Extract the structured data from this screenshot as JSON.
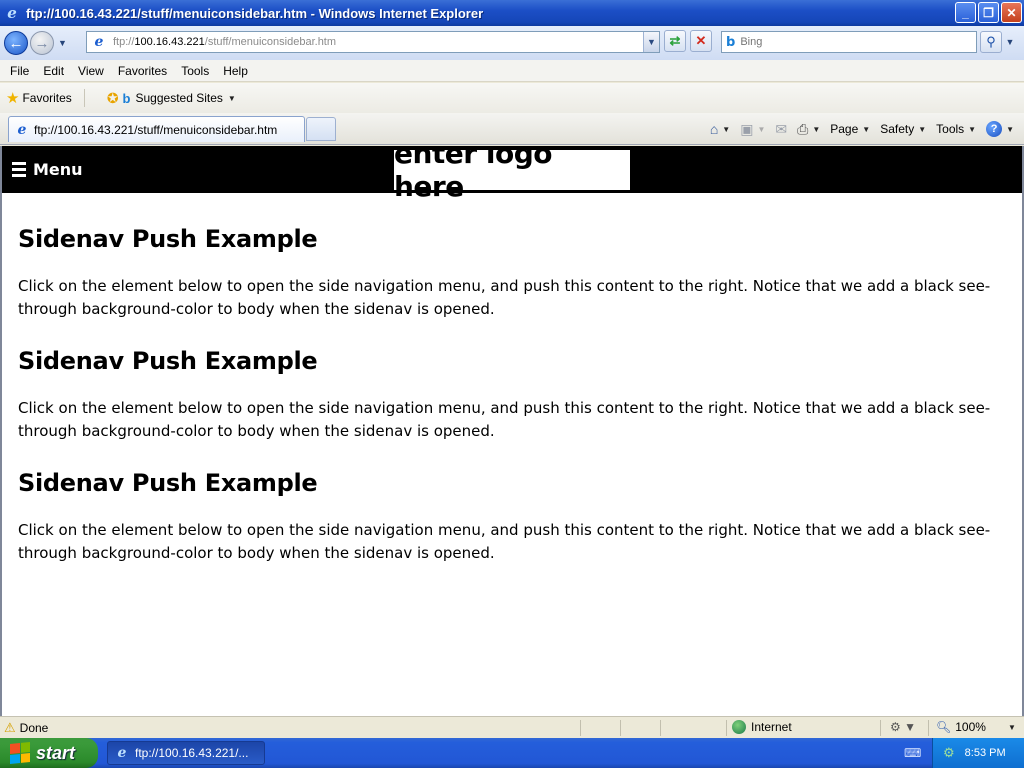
{
  "window": {
    "title": "ftp://100.16.43.221/stuff/menuiconsidebar.htm - Windows Internet Explorer",
    "buttons": {
      "minimize": "_",
      "maximize": "❐",
      "close": "✕"
    }
  },
  "address": {
    "prefix": "ftp://",
    "host": "100.16.43.221",
    "path": "/stuff/menuiconsidebar.htm"
  },
  "search": {
    "placeholder": "Bing"
  },
  "menubar": {
    "file": "File",
    "edit": "Edit",
    "view": "View",
    "favorites": "Favorites",
    "tools": "Tools",
    "help": "Help"
  },
  "favbar": {
    "favorites_label": "Favorites",
    "suggested_label": "Suggested Sites"
  },
  "tab": {
    "label": "ftp://100.16.43.221/stuff/menuiconsidebar.htm"
  },
  "cmdbar": {
    "page": "Page",
    "safety": "Safety",
    "tools": "Tools"
  },
  "site": {
    "menu_label": "Menu",
    "logo_text": "enter logo here",
    "sections": [
      {
        "heading": "Sidenav Push Example",
        "text": "Click on the element below to open the side navigation menu, and push this content to the right. Notice that we add a black see-through background-color to body when the sidenav is opened."
      },
      {
        "heading": "Sidenav Push Example",
        "text": "Click on the element below to open the side navigation menu, and push this content to the right. Notice that we add a black see-through background-color to body when the sidenav is opened."
      },
      {
        "heading": "Sidenav Push Example",
        "text": "Click on the element below to open the side navigation menu, and push this content to the right. Notice that we add a black see-through background-color to body when the sidenav is opened."
      }
    ]
  },
  "status": {
    "text": "Done",
    "zone": "Internet",
    "zoom": "100%"
  },
  "taskbar": {
    "start": "start",
    "task_item": "ftp://100.16.43.221/...",
    "clock": "8:53 PM"
  },
  "icons": {
    "ie": "ie-icon",
    "back": "back-arrow-icon",
    "forward": "forward-arrow-icon",
    "refresh": "refresh-icon",
    "stop": "stop-icon",
    "search": "magnifier-icon",
    "home": "home-icon",
    "feeds": "rss-feed-icon",
    "mail": "mail-icon",
    "print": "printer-icon",
    "help": "help-icon"
  }
}
